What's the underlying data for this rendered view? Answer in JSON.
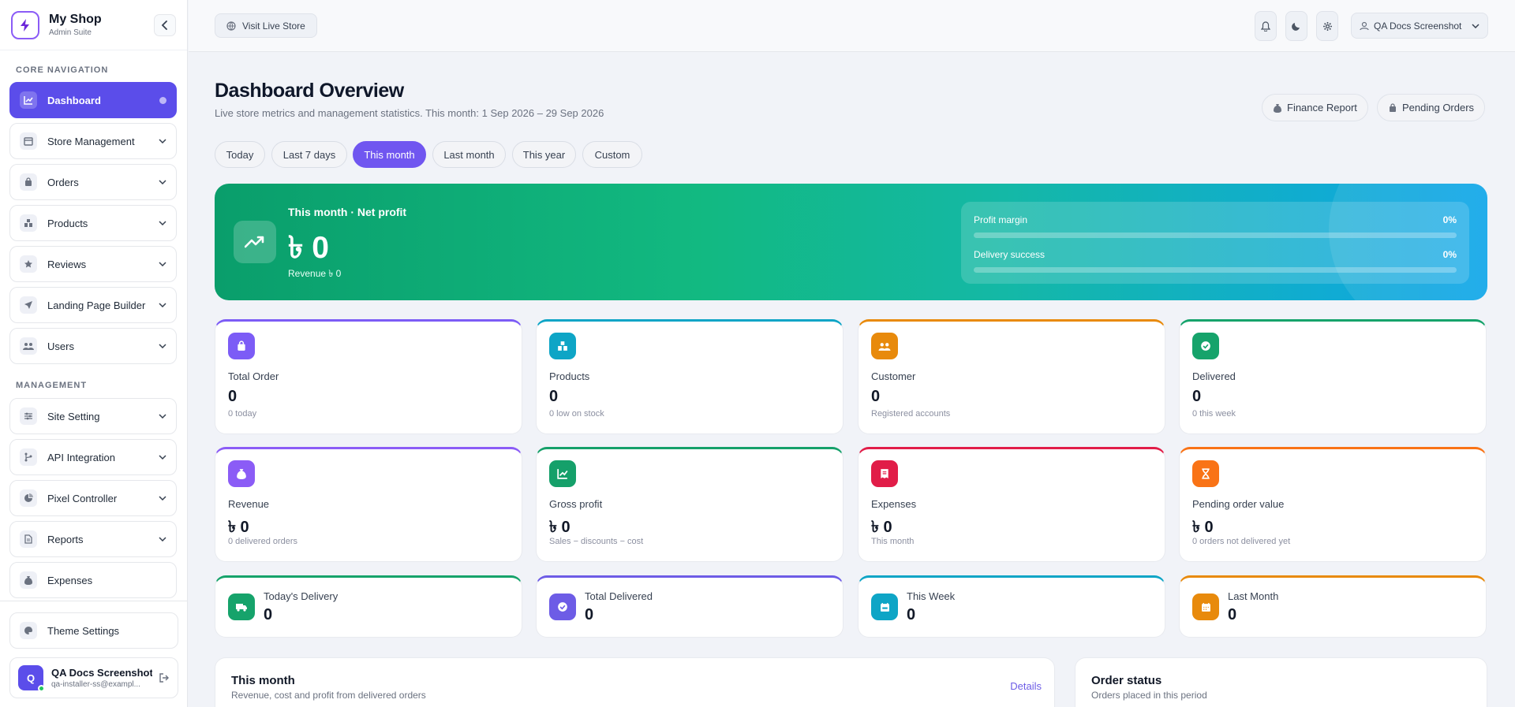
{
  "brand": {
    "name": "My Shop",
    "subtitle": "Admin Suite"
  },
  "sidebar": {
    "section_core": "CORE NAVIGATION",
    "section_management": "MANAGEMENT",
    "core_items": [
      {
        "label": "Dashboard",
        "icon": "chart-line-icon",
        "active": true
      },
      {
        "label": "Store Management",
        "icon": "store-icon"
      },
      {
        "label": "Orders",
        "icon": "shopping-bag-icon"
      },
      {
        "label": "Products",
        "icon": "boxes-icon"
      },
      {
        "label": "Reviews",
        "icon": "star-icon"
      },
      {
        "label": "Landing Page Builder",
        "icon": "paper-plane-icon"
      },
      {
        "label": "Users",
        "icon": "users-icon"
      }
    ],
    "management_items": [
      {
        "label": "Site Setting",
        "icon": "sliders-icon"
      },
      {
        "label": "API Integration",
        "icon": "code-branch-icon"
      },
      {
        "label": "Pixel Controller",
        "icon": "pie-chart-icon"
      },
      {
        "label": "Reports",
        "icon": "file-icon"
      },
      {
        "label": "Expenses",
        "icon": "money-bag-icon"
      }
    ],
    "theme_settings": "Theme Settings",
    "user": {
      "initial": "Q",
      "name": "QA Docs Screenshot",
      "email": "qa-installer-ss@exampl..."
    }
  },
  "topbar": {
    "visit_store": "Visit Live Store",
    "account": "QA Docs Screenshot"
  },
  "header": {
    "title": "Dashboard Overview",
    "subtitle": "Live store metrics and management statistics. This month: 1 Sep 2026 – 29 Sep 2026",
    "finance_report": "Finance Report",
    "pending_orders": "Pending Orders"
  },
  "filters": [
    "Today",
    "Last 7 days",
    "This month",
    "Last month",
    "This year",
    "Custom"
  ],
  "active_filter": "This month",
  "hero": {
    "label": "This month · Net profit",
    "value": "৳ 0",
    "revenue": "Revenue ৳ 0",
    "profit_margin_label": "Profit margin",
    "profit_margin_value": "0%",
    "profit_margin_fraction": 0,
    "delivery_success_label": "Delivery success",
    "delivery_success_value": "0%",
    "delivery_success_fraction": 0
  },
  "stats": [
    {
      "label": "Total Order",
      "value": "0",
      "sub": "0 today",
      "icon": "shopping-bag-icon",
      "color": "#7c5cf6"
    },
    {
      "label": "Products",
      "value": "0",
      "sub": "0 low on stock",
      "icon": "boxes-icon",
      "color": "#0ea5c6"
    },
    {
      "label": "Customer",
      "value": "0",
      "sub": "Registered accounts",
      "icon": "users-icon",
      "color": "#e88a0c"
    },
    {
      "label": "Delivered",
      "value": "0",
      "sub": "0 this week",
      "icon": "check-circle-icon",
      "color": "#16a36b"
    },
    {
      "label": "Revenue",
      "value": "৳ 0",
      "sub": "0 delivered orders",
      "icon": "money-bag-icon",
      "color": "#8b5cf6"
    },
    {
      "label": "Gross profit",
      "value": "৳ 0",
      "sub": "Sales − discounts − cost",
      "icon": "chart-line-icon",
      "color": "#15a06a"
    },
    {
      "label": "Expenses",
      "value": "৳ 0",
      "sub": "This month",
      "icon": "receipt-icon",
      "color": "#e11d48"
    },
    {
      "label": "Pending order value",
      "value": "৳ 0",
      "sub": "0 orders not delivered yet",
      "icon": "hourglass-icon",
      "color": "#f97316"
    }
  ],
  "mini_stats": [
    {
      "label": "Today's Delivery",
      "value": "0",
      "icon": "truck-icon",
      "color": "#16a36b"
    },
    {
      "label": "Total Delivered",
      "value": "0",
      "icon": "check-circle-icon",
      "color": "#6d5ce6"
    },
    {
      "label": "This Week",
      "value": "0",
      "icon": "calendar-week-icon",
      "color": "#0ea5c6"
    },
    {
      "label": "Last Month",
      "value": "0",
      "icon": "calendar-icon",
      "color": "#e88a0c"
    }
  ],
  "panels": {
    "month_title": "This month",
    "month_sub": "Revenue, cost and profit from delivered orders",
    "details": "Details",
    "status_title": "Order status",
    "status_sub": "Orders placed in this period"
  }
}
